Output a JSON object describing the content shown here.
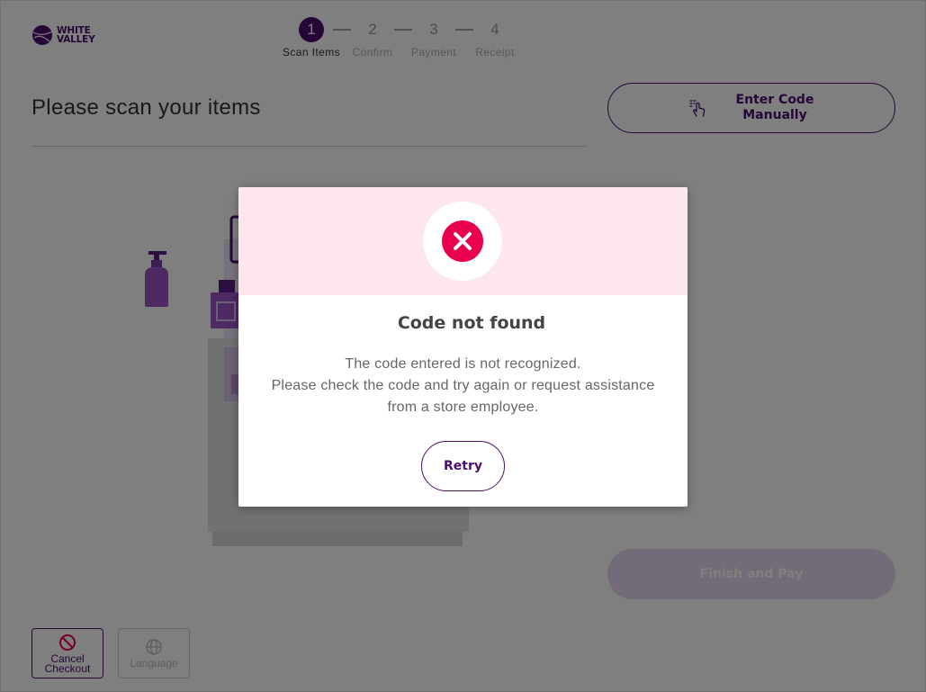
{
  "brand": {
    "name_line1": "WHITE",
    "name_line2": "VALLEY",
    "color": "#4a0d6e"
  },
  "stepper": {
    "steps": [
      {
        "number": "1",
        "label": "Scan Items",
        "active": true
      },
      {
        "number": "2",
        "label": "Confirm",
        "active": false
      },
      {
        "number": "3",
        "label": "Payment",
        "active": false
      },
      {
        "number": "4",
        "label": "Receipt",
        "active": false
      }
    ]
  },
  "main": {
    "heading": "Please scan your items",
    "enter_code_label": "Enter Code Manually",
    "finish_label": "Finish and Pay"
  },
  "footer": {
    "cancel_label": "Cancel Checkout",
    "language_label": "Language"
  },
  "modal": {
    "title": "Code not found",
    "message_lines": [
      "The code entered is not recognized.",
      "Please check the code and try again or request assistance",
      "from a store employee."
    ],
    "retry_label": "Retry",
    "error_color": "#e8004c",
    "header_bg": "#fde7ec"
  },
  "icons": {
    "enter_code": "tap-hand-icon",
    "cancel": "prohibited-icon",
    "language": "globe-icon",
    "error": "error-x-icon"
  }
}
